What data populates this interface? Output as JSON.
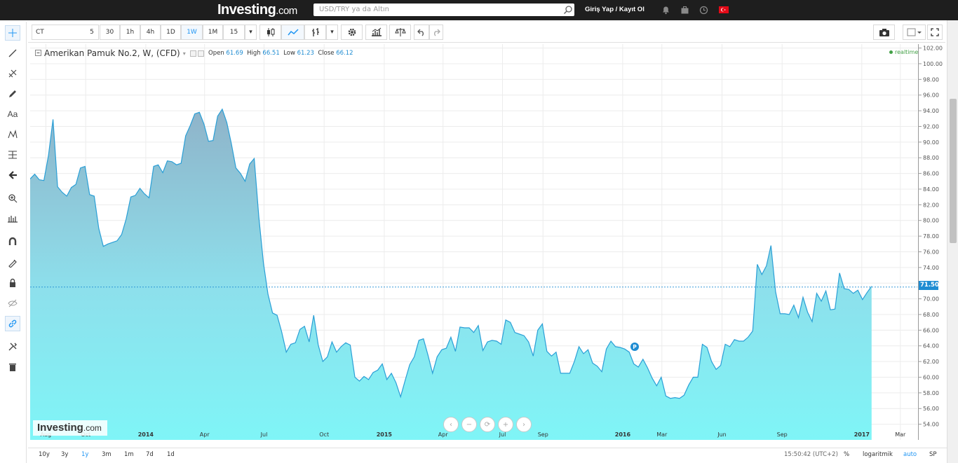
{
  "topbar": {
    "logo": "Investing",
    "logo_suffix": ".com",
    "search_placeholder": "USD/TRY ya da Altın",
    "login": "Giriş Yap / Kayıt Ol"
  },
  "toolbar": {
    "symbol": "CT",
    "intervals": [
      "5",
      "30",
      "1h",
      "4h",
      "1D",
      "1W",
      "1M"
    ],
    "active_interval": "1W",
    "custom_interval": "15"
  },
  "legend": {
    "title": "Amerikan Pamuk No.2, W, (CFD)",
    "open_label": "Open",
    "open": "61.69",
    "high_label": "High",
    "high": "66.51",
    "low_label": "Low",
    "low": "61.23",
    "close_label": "Close",
    "close": "66.12",
    "realtime": "realtime"
  },
  "current_price": "71.50",
  "marker_label": "P",
  "watermark": {
    "name": "Investing",
    "suffix": ".com"
  },
  "bottombar": {
    "ranges": [
      "10y",
      "3y",
      "1y",
      "3m",
      "1m",
      "7d",
      "1d"
    ],
    "active_range": "1y",
    "time": "15:50:42 (UTC+2)",
    "percent": "%",
    "log": "logaritmik",
    "auto": "auto",
    "sp": "SP"
  },
  "colors": {
    "line": "#2a9fd6",
    "fill_top": "#8fb3c9",
    "fill_bottom": "#7ff5f7",
    "accent": "#2196f3"
  },
  "chart_data": {
    "type": "area",
    "x_tick_labels": [
      "Aug",
      "Oct",
      "2014",
      "Apr",
      "Jul",
      "Oct",
      "2015",
      "Apr",
      "Jul",
      "Sep",
      "2016",
      "Mar",
      "Jun",
      "Sep",
      "2017",
      "Mar"
    ],
    "y_tick_labels": [
      "54.00",
      "56.00",
      "58.00",
      "60.00",
      "62.00",
      "64.00",
      "66.00",
      "68.00",
      "70.00",
      "72.00",
      "74.00",
      "76.00",
      "78.00",
      "80.00",
      "82.00",
      "84.00",
      "86.00",
      "88.00",
      "90.00",
      "92.00",
      "94.00",
      "96.00",
      "98.00",
      "100.00",
      "102.00"
    ],
    "ylim": [
      52,
      102.5
    ],
    "x_range": [
      "2013-07-08",
      "2017-03-27"
    ],
    "series": [
      {
        "points": [
          [
            "2013-07-08",
            85.3
          ],
          [
            "2013-07-15",
            85.9
          ],
          [
            "2013-07-22",
            85.2
          ],
          [
            "2013-07-29",
            85.1
          ],
          [
            "2013-08-05",
            88.3
          ],
          [
            "2013-08-12",
            92.9
          ],
          [
            "2013-08-19",
            84.3
          ],
          [
            "2013-08-26",
            83.6
          ],
          [
            "2013-09-02",
            83.1
          ],
          [
            "2013-09-09",
            84.2
          ],
          [
            "2013-09-16",
            84.6
          ],
          [
            "2013-09-23",
            86.7
          ],
          [
            "2013-09-30",
            86.9
          ],
          [
            "2013-10-07",
            83.3
          ],
          [
            "2013-10-14",
            83.1
          ],
          [
            "2013-10-21",
            79.0
          ],
          [
            "2013-10-28",
            76.7
          ],
          [
            "2013-11-04",
            77.0
          ],
          [
            "2013-11-11",
            77.2
          ],
          [
            "2013-11-18",
            77.4
          ],
          [
            "2013-11-25",
            78.2
          ],
          [
            "2013-12-02",
            80.2
          ],
          [
            "2013-12-09",
            83.0
          ],
          [
            "2013-12-16",
            83.2
          ],
          [
            "2013-12-23",
            84.1
          ],
          [
            "2013-12-30",
            83.4
          ],
          [
            "2014-01-06",
            82.9
          ],
          [
            "2014-01-13",
            86.9
          ],
          [
            "2014-01-20",
            87.1
          ],
          [
            "2014-01-27",
            86.1
          ],
          [
            "2014-02-03",
            87.6
          ],
          [
            "2014-02-10",
            87.5
          ],
          [
            "2014-02-17",
            87.1
          ],
          [
            "2014-02-24",
            87.3
          ],
          [
            "2014-03-03",
            90.8
          ],
          [
            "2014-03-10",
            92.1
          ],
          [
            "2014-03-17",
            93.6
          ],
          [
            "2014-03-24",
            93.8
          ],
          [
            "2014-03-31",
            92.3
          ],
          [
            "2014-04-07",
            90.1
          ],
          [
            "2014-04-14",
            90.2
          ],
          [
            "2014-04-21",
            93.3
          ],
          [
            "2014-04-28",
            94.2
          ],
          [
            "2014-05-05",
            92.5
          ],
          [
            "2014-05-12",
            89.8
          ],
          [
            "2014-05-19",
            86.7
          ],
          [
            "2014-05-26",
            86.0
          ],
          [
            "2014-06-02",
            85.0
          ],
          [
            "2014-06-09",
            87.2
          ],
          [
            "2014-06-16",
            87.9
          ],
          [
            "2014-06-23",
            80.5
          ],
          [
            "2014-06-30",
            74.6
          ],
          [
            "2014-07-07",
            70.6
          ],
          [
            "2014-07-14",
            68.2
          ],
          [
            "2014-07-21",
            67.9
          ],
          [
            "2014-07-28",
            65.8
          ],
          [
            "2014-08-04",
            63.2
          ],
          [
            "2014-08-11",
            64.2
          ],
          [
            "2014-08-18",
            64.4
          ],
          [
            "2014-08-25",
            66.1
          ],
          [
            "2014-09-01",
            66.5
          ],
          [
            "2014-09-08",
            64.5
          ],
          [
            "2014-09-15",
            67.9
          ],
          [
            "2014-09-22",
            64.1
          ],
          [
            "2014-09-29",
            62.0
          ],
          [
            "2014-10-06",
            62.6
          ],
          [
            "2014-10-13",
            64.5
          ],
          [
            "2014-10-20",
            63.2
          ],
          [
            "2014-10-27",
            63.9
          ],
          [
            "2014-11-03",
            64.4
          ],
          [
            "2014-11-10",
            64.1
          ],
          [
            "2014-11-17",
            60.0
          ],
          [
            "2014-11-24",
            59.5
          ],
          [
            "2014-12-01",
            60.1
          ],
          [
            "2014-12-08",
            59.7
          ],
          [
            "2014-12-15",
            60.6
          ],
          [
            "2014-12-22",
            60.9
          ],
          [
            "2014-12-29",
            61.7
          ],
          [
            "2015-01-05",
            59.7
          ],
          [
            "2015-01-12",
            60.5
          ],
          [
            "2015-01-19",
            59.3
          ],
          [
            "2015-01-26",
            57.5
          ],
          [
            "2015-02-02",
            59.6
          ],
          [
            "2015-02-09",
            61.6
          ],
          [
            "2015-02-16",
            62.6
          ],
          [
            "2015-02-23",
            64.7
          ],
          [
            "2015-03-02",
            64.9
          ],
          [
            "2015-03-09",
            62.8
          ],
          [
            "2015-03-16",
            60.5
          ],
          [
            "2015-03-23",
            62.6
          ],
          [
            "2015-03-30",
            63.5
          ],
          [
            "2015-04-06",
            63.7
          ],
          [
            "2015-04-13",
            65.1
          ],
          [
            "2015-04-20",
            63.3
          ],
          [
            "2015-04-27",
            66.4
          ],
          [
            "2015-05-04",
            66.3
          ],
          [
            "2015-05-11",
            66.3
          ],
          [
            "2015-05-18",
            65.7
          ],
          [
            "2015-05-25",
            66.6
          ],
          [
            "2015-06-01",
            63.4
          ],
          [
            "2015-06-08",
            64.5
          ],
          [
            "2015-06-15",
            64.7
          ],
          [
            "2015-06-22",
            64.6
          ],
          [
            "2015-06-29",
            64.2
          ],
          [
            "2015-07-06",
            67.3
          ],
          [
            "2015-07-13",
            67.0
          ],
          [
            "2015-07-20",
            65.7
          ],
          [
            "2015-07-27",
            65.5
          ],
          [
            "2015-08-03",
            65.3
          ],
          [
            "2015-08-10",
            64.5
          ],
          [
            "2015-08-17",
            62.7
          ],
          [
            "2015-08-24",
            66.0
          ],
          [
            "2015-08-31",
            66.8
          ],
          [
            "2015-09-07",
            63.3
          ],
          [
            "2015-09-14",
            62.7
          ],
          [
            "2015-09-21",
            63.2
          ],
          [
            "2015-09-28",
            60.5
          ],
          [
            "2015-10-05",
            60.5
          ],
          [
            "2015-10-12",
            60.5
          ],
          [
            "2015-10-19",
            62.0
          ],
          [
            "2015-10-26",
            63.9
          ],
          [
            "2015-11-02",
            63.0
          ],
          [
            "2015-11-09",
            63.5
          ],
          [
            "2015-11-16",
            61.8
          ],
          [
            "2015-11-23",
            61.4
          ],
          [
            "2015-11-30",
            60.7
          ],
          [
            "2015-12-07",
            63.6
          ],
          [
            "2015-12-14",
            64.6
          ],
          [
            "2015-12-21",
            63.9
          ],
          [
            "2015-12-28",
            63.8
          ],
          [
            "2016-01-04",
            63.6
          ],
          [
            "2016-01-11",
            63.2
          ],
          [
            "2016-01-18",
            61.7
          ],
          [
            "2016-01-25",
            61.3
          ],
          [
            "2016-02-01",
            62.3
          ],
          [
            "2016-02-08",
            61.2
          ],
          [
            "2016-02-15",
            59.9
          ],
          [
            "2016-02-22",
            58.9
          ],
          [
            "2016-02-29",
            60.0
          ],
          [
            "2016-03-07",
            57.6
          ],
          [
            "2016-03-14",
            57.3
          ],
          [
            "2016-03-21",
            57.4
          ],
          [
            "2016-03-28",
            57.3
          ],
          [
            "2016-04-04",
            57.7
          ],
          [
            "2016-04-11",
            59.0
          ],
          [
            "2016-04-18",
            60.0
          ],
          [
            "2016-04-25",
            60.0
          ],
          [
            "2016-05-02",
            64.2
          ],
          [
            "2016-05-09",
            63.8
          ],
          [
            "2016-05-16",
            62.0
          ],
          [
            "2016-05-23",
            61.0
          ],
          [
            "2016-05-30",
            61.5
          ],
          [
            "2016-06-06",
            64.2
          ],
          [
            "2016-06-13",
            63.9
          ],
          [
            "2016-06-20",
            64.8
          ],
          [
            "2016-06-27",
            64.6
          ],
          [
            "2016-07-04",
            64.6
          ],
          [
            "2016-07-11",
            65.1
          ],
          [
            "2016-07-18",
            65.9
          ],
          [
            "2016-07-25",
            74.4
          ],
          [
            "2016-08-01",
            73.1
          ],
          [
            "2016-08-08",
            74.2
          ],
          [
            "2016-08-15",
            76.8
          ],
          [
            "2016-08-22",
            70.9
          ],
          [
            "2016-08-29",
            68.1
          ],
          [
            "2016-09-05",
            68.1
          ],
          [
            "2016-09-12",
            68.0
          ],
          [
            "2016-09-19",
            69.2
          ],
          [
            "2016-09-26",
            67.6
          ],
          [
            "2016-10-03",
            70.2
          ],
          [
            "2016-10-10",
            68.3
          ],
          [
            "2016-10-17",
            67.1
          ],
          [
            "2016-10-24",
            70.7
          ],
          [
            "2016-10-31",
            69.7
          ],
          [
            "2016-11-07",
            71.0
          ],
          [
            "2016-11-14",
            68.6
          ],
          [
            "2016-11-21",
            68.7
          ],
          [
            "2016-11-28",
            73.3
          ],
          [
            "2016-12-05",
            71.3
          ],
          [
            "2016-12-12",
            71.2
          ],
          [
            "2016-12-19",
            70.7
          ],
          [
            "2016-12-26",
            71.1
          ],
          [
            "2017-01-02",
            69.9
          ],
          [
            "2017-01-09",
            70.8
          ],
          [
            "2017-01-16",
            71.6
          ]
        ]
      }
    ]
  }
}
